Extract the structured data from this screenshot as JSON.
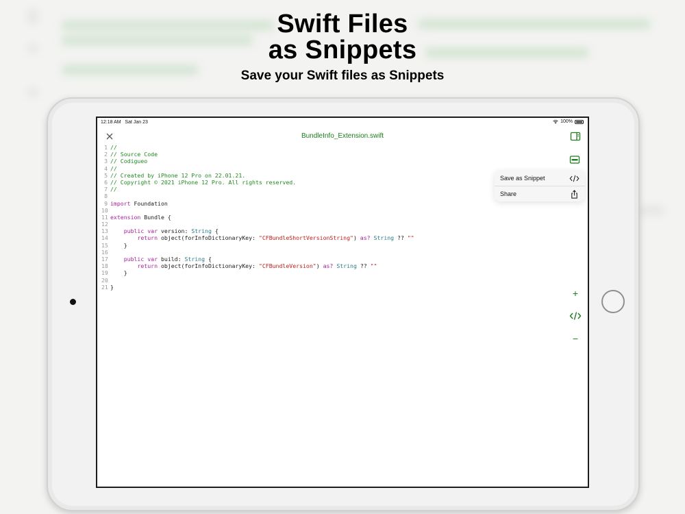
{
  "headline": {
    "title_line1": "Swift Files",
    "title_line2": "as Snippets",
    "subtitle": "Save your Swift files as Snippets"
  },
  "status_bar": {
    "time": "12:18 AM",
    "date": "Sat Jan 23",
    "battery": "100%"
  },
  "editor": {
    "file_name": "BundleInfo_Extension.swift"
  },
  "code_lines": [
    {
      "n": "1",
      "parts": [
        {
          "t": "//",
          "c": "comment"
        }
      ]
    },
    {
      "n": "2",
      "parts": [
        {
          "t": "// Source Code",
          "c": "comment"
        }
      ]
    },
    {
      "n": "3",
      "parts": [
        {
          "t": "// Codigueo",
          "c": "comment"
        }
      ]
    },
    {
      "n": "4",
      "parts": [
        {
          "t": "//",
          "c": "comment"
        }
      ]
    },
    {
      "n": "5",
      "parts": [
        {
          "t": "// Created by iPhone 12 Pro on 22.01.21.",
          "c": "comment"
        }
      ]
    },
    {
      "n": "6",
      "parts": [
        {
          "t": "// Copyright © 2021 iPhone 12 Pro. All rights reserved.",
          "c": "comment"
        }
      ]
    },
    {
      "n": "7",
      "parts": [
        {
          "t": "//",
          "c": "comment"
        }
      ]
    },
    {
      "n": "8",
      "parts": []
    },
    {
      "n": "9",
      "parts": [
        {
          "t": "import",
          "c": "kw"
        },
        {
          "t": " Foundation",
          "c": ""
        }
      ]
    },
    {
      "n": "10",
      "parts": []
    },
    {
      "n": "11",
      "parts": [
        {
          "t": "extension",
          "c": "kw"
        },
        {
          "t": " Bundle {",
          "c": ""
        }
      ]
    },
    {
      "n": "12",
      "parts": []
    },
    {
      "n": "13",
      "parts": [
        {
          "t": "    ",
          "c": ""
        },
        {
          "t": "public",
          "c": "kw"
        },
        {
          "t": " ",
          "c": ""
        },
        {
          "t": "var",
          "c": "kw"
        },
        {
          "t": " version: ",
          "c": ""
        },
        {
          "t": "String",
          "c": "type"
        },
        {
          "t": " {",
          "c": ""
        }
      ]
    },
    {
      "n": "14",
      "parts": [
        {
          "t": "        ",
          "c": ""
        },
        {
          "t": "return",
          "c": "kw"
        },
        {
          "t": " object(forInfoDictionaryKey: ",
          "c": ""
        },
        {
          "t": "\"CFBundleShortVersionString\"",
          "c": "str"
        },
        {
          "t": ") ",
          "c": ""
        },
        {
          "t": "as?",
          "c": "kw"
        },
        {
          "t": " ",
          "c": ""
        },
        {
          "t": "String",
          "c": "type"
        },
        {
          "t": " ?? ",
          "c": ""
        },
        {
          "t": "\"\"",
          "c": "str"
        }
      ]
    },
    {
      "n": "15",
      "parts": [
        {
          "t": "    }",
          "c": ""
        }
      ]
    },
    {
      "n": "16",
      "parts": []
    },
    {
      "n": "17",
      "parts": [
        {
          "t": "    ",
          "c": ""
        },
        {
          "t": "public",
          "c": "kw"
        },
        {
          "t": " ",
          "c": ""
        },
        {
          "t": "var",
          "c": "kw"
        },
        {
          "t": " build: ",
          "c": ""
        },
        {
          "t": "String",
          "c": "type"
        },
        {
          "t": " {",
          "c": ""
        }
      ]
    },
    {
      "n": "18",
      "parts": [
        {
          "t": "        ",
          "c": ""
        },
        {
          "t": "return",
          "c": "kw"
        },
        {
          "t": " object(forInfoDictionaryKey: ",
          "c": ""
        },
        {
          "t": "\"CFBundleVersion\"",
          "c": "str"
        },
        {
          "t": ") ",
          "c": ""
        },
        {
          "t": "as?",
          "c": "kw"
        },
        {
          "t": " ",
          "c": ""
        },
        {
          "t": "String",
          "c": "type"
        },
        {
          "t": " ?? ",
          "c": ""
        },
        {
          "t": "\"\"",
          "c": "str"
        }
      ]
    },
    {
      "n": "19",
      "parts": [
        {
          "t": "    }",
          "c": ""
        }
      ]
    },
    {
      "n": "20",
      "parts": []
    },
    {
      "n": "21",
      "parts": [
        {
          "t": "}",
          "c": ""
        }
      ]
    }
  ],
  "context_menu": {
    "items": [
      {
        "label": "Save as Snippet",
        "icon": "code-brackets-icon"
      },
      {
        "label": "Share",
        "icon": "share-icon"
      }
    ]
  },
  "side_tools": {
    "zoom_in": "+",
    "zoom_out": "−"
  },
  "colors": {
    "accent_green": "#1b7d1b",
    "comment": "#1f8a1f",
    "keyword": "#a7239a",
    "type": "#2c7b8d",
    "string": "#c41a16"
  }
}
